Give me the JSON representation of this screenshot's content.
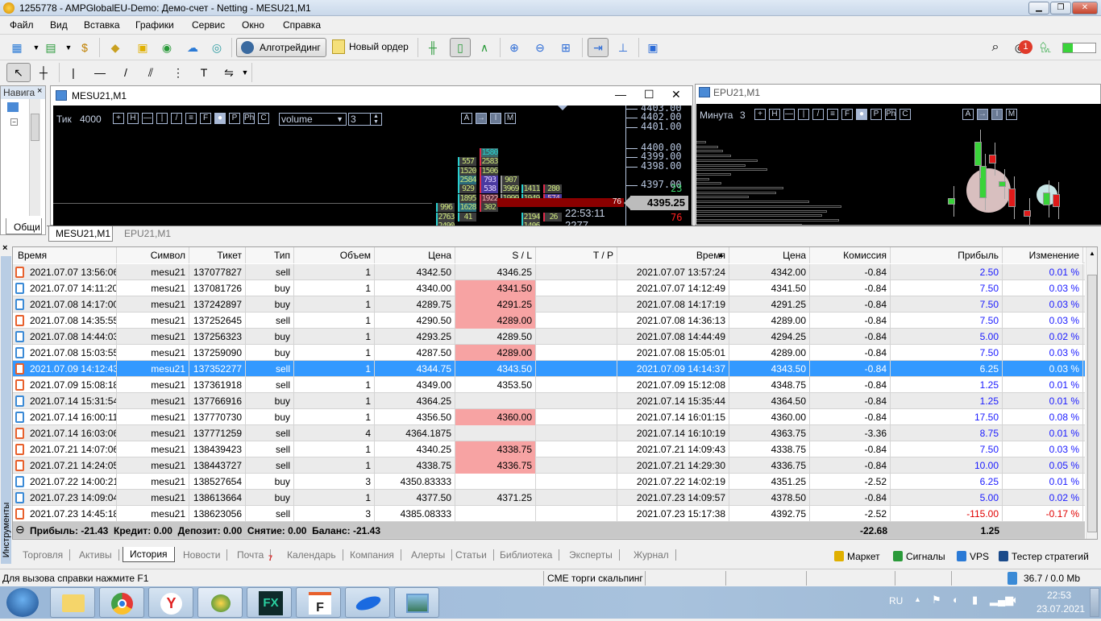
{
  "window": {
    "title": "1255778 - AMPGlobalEU-Demo: Демо-счет - Netting - MESU21,M1"
  },
  "menu": [
    "Файл",
    "Вид",
    "Вставка",
    "Графики",
    "Сервис",
    "Окно",
    "Справка"
  ],
  "toolbar": {
    "algo_label": "Алготрейдинг",
    "new_order_label": "Новый ордер",
    "notifications_count": "1",
    "lvl_label": "LVL",
    "signal_strength": 0.3
  },
  "navigator": {
    "title": "Навига",
    "tab": "Общи"
  },
  "chart_main": {
    "title": "MESU21,M1",
    "timeframe_label": "Тик",
    "timeframe_value": "4000",
    "mode_select": "volume",
    "mode_value": "3",
    "tool_buttons": [
      "+",
      "H",
      "—",
      "|",
      "/",
      "≡",
      "F",
      "●",
      "P",
      "Ph",
      "C"
    ],
    "right_buttons": [
      "A",
      "→",
      "I",
      "M"
    ],
    "price_labels": [
      "4403.00",
      "4402.00",
      "4401.00",
      "4400.00",
      "4399.00",
      "4398.00",
      "4397.00"
    ],
    "ask_volume": "23",
    "current_price": "4395.25",
    "bid_volume": "76",
    "level_volume": "76",
    "time": "22:53:11",
    "tick_count": "2277",
    "clusters": [
      {
        "start": 6,
        "values": [
          "996",
          "2763",
          "2490"
        ]
      },
      {
        "start": 1,
        "values": [
          "557",
          "1520",
          "2584",
          "929",
          "1895",
          "1628",
          "41"
        ]
      },
      {
        "start": 0,
        "values": [
          "1580",
          "2583",
          "1506",
          "793",
          "538",
          "1922",
          "302"
        ]
      },
      {
        "start": 3,
        "values": [
          "907",
          "3969",
          "1999"
        ]
      },
      {
        "start": 4,
        "values": [
          "1411",
          "1949",
          "",
          "2194",
          "1406"
        ]
      },
      {
        "start": 4,
        "values": [
          "280",
          "574",
          "",
          "26"
        ]
      }
    ]
  },
  "chart_second": {
    "title": "EPU21,M1",
    "timeframe_label": "Минута",
    "timeframe_value": "3",
    "tool_buttons": [
      "+",
      "H",
      "—",
      "|",
      "/",
      "≡",
      "F",
      "●",
      "P",
      "Ph",
      "C"
    ],
    "right_buttons": [
      "A",
      "→",
      "I",
      "M"
    ]
  },
  "chart_tabs": [
    "MESU21,M1",
    "EPU21,M1"
  ],
  "history": {
    "columns": [
      "Время",
      "Символ",
      "Тикет",
      "Тип",
      "Объем",
      "Цена",
      "S / L",
      "T / P",
      "Время",
      "Цена",
      "Комиссия",
      "Прибыль",
      "Изменение"
    ],
    "rows": [
      {
        "open_time": "2021.07.07 13:56:06",
        "symbol": "mesu21",
        "ticket": "137077827",
        "type": "sell",
        "volume": "1",
        "price": "4342.50",
        "sl": "4346.25",
        "sl_hit": false,
        "tp": "",
        "close_time": "2021.07.07 13:57:24",
        "close_price": "4342.00",
        "commission": "-0.84",
        "profit": "2.50",
        "change": "0.01 %"
      },
      {
        "open_time": "2021.07.07 14:11:20",
        "symbol": "mesu21",
        "ticket": "137081726",
        "type": "buy",
        "volume": "1",
        "price": "4340.00",
        "sl": "4341.50",
        "sl_hit": true,
        "tp": "",
        "close_time": "2021.07.07 14:12:49",
        "close_price": "4341.50",
        "commission": "-0.84",
        "profit": "7.50",
        "change": "0.03 %"
      },
      {
        "open_time": "2021.07.08 14:17:00",
        "symbol": "mesu21",
        "ticket": "137242897",
        "type": "buy",
        "volume": "1",
        "price": "4289.75",
        "sl": "4291.25",
        "sl_hit": true,
        "tp": "",
        "close_time": "2021.07.08 14:17:19",
        "close_price": "4291.25",
        "commission": "-0.84",
        "profit": "7.50",
        "change": "0.03 %"
      },
      {
        "open_time": "2021.07.08 14:35:55",
        "symbol": "mesu21",
        "ticket": "137252645",
        "type": "sell",
        "volume": "1",
        "price": "4290.50",
        "sl": "4289.00",
        "sl_hit": true,
        "tp": "",
        "close_time": "2021.07.08 14:36:13",
        "close_price": "4289.00",
        "commission": "-0.84",
        "profit": "7.50",
        "change": "0.03 %"
      },
      {
        "open_time": "2021.07.08 14:44:03",
        "symbol": "mesu21",
        "ticket": "137256323",
        "type": "buy",
        "volume": "1",
        "price": "4293.25",
        "sl": "4289.50",
        "sl_hit": false,
        "tp": "",
        "close_time": "2021.07.08 14:44:49",
        "close_price": "4294.25",
        "commission": "-0.84",
        "profit": "5.00",
        "change": "0.02 %"
      },
      {
        "open_time": "2021.07.08 15:03:55",
        "symbol": "mesu21",
        "ticket": "137259090",
        "type": "buy",
        "volume": "1",
        "price": "4287.50",
        "sl": "4289.00",
        "sl_hit": true,
        "tp": "",
        "close_time": "2021.07.08 15:05:01",
        "close_price": "4289.00",
        "commission": "-0.84",
        "profit": "7.50",
        "change": "0.03 %"
      },
      {
        "open_time": "2021.07.09 14:12:43",
        "symbol": "mesu21",
        "ticket": "137352277",
        "type": "sell",
        "volume": "1",
        "price": "4344.75",
        "sl": "4343.50",
        "sl_hit": true,
        "tp": "",
        "close_time": "2021.07.09 14:14:37",
        "close_price": "4343.50",
        "commission": "-0.84",
        "profit": "6.25",
        "change": "0.03 %",
        "selected": true
      },
      {
        "open_time": "2021.07.09 15:08:18",
        "symbol": "mesu21",
        "ticket": "137361918",
        "type": "sell",
        "volume": "1",
        "price": "4349.00",
        "sl": "4353.50",
        "sl_hit": false,
        "tp": "",
        "close_time": "2021.07.09 15:12:08",
        "close_price": "4348.75",
        "commission": "-0.84",
        "profit": "1.25",
        "change": "0.01 %"
      },
      {
        "open_time": "2021.07.14 15:31:54",
        "symbol": "mesu21",
        "ticket": "137766916",
        "type": "buy",
        "volume": "1",
        "price": "4364.25",
        "sl": "",
        "sl_hit": false,
        "tp": "",
        "close_time": "2021.07.14 15:35:44",
        "close_price": "4364.50",
        "commission": "-0.84",
        "profit": "1.25",
        "change": "0.01 %"
      },
      {
        "open_time": "2021.07.14 16:00:11",
        "symbol": "mesu21",
        "ticket": "137770730",
        "type": "buy",
        "volume": "1",
        "price": "4356.50",
        "sl": "4360.00",
        "sl_hit": true,
        "tp": "",
        "close_time": "2021.07.14 16:01:15",
        "close_price": "4360.00",
        "commission": "-0.84",
        "profit": "17.50",
        "change": "0.08 %"
      },
      {
        "open_time": "2021.07.14 16:03:06",
        "symbol": "mesu21",
        "ticket": "137771259",
        "type": "sell",
        "volume": "4",
        "price": "4364.1875",
        "sl": "",
        "sl_hit": false,
        "tp": "",
        "close_time": "2021.07.14 16:10:19",
        "close_price": "4363.75",
        "commission": "-3.36",
        "profit": "8.75",
        "change": "0.01 %"
      },
      {
        "open_time": "2021.07.21 14:07:06",
        "symbol": "mesu21",
        "ticket": "138439423",
        "type": "sell",
        "volume": "1",
        "price": "4340.25",
        "sl": "4338.75",
        "sl_hit": true,
        "tp": "",
        "close_time": "2021.07.21 14:09:43",
        "close_price": "4338.75",
        "commission": "-0.84",
        "profit": "7.50",
        "change": "0.03 %"
      },
      {
        "open_time": "2021.07.21 14:24:05",
        "symbol": "mesu21",
        "ticket": "138443727",
        "type": "sell",
        "volume": "1",
        "price": "4338.75",
        "sl": "4336.75",
        "sl_hit": true,
        "tp": "",
        "close_time": "2021.07.21 14:29:30",
        "close_price": "4336.75",
        "commission": "-0.84",
        "profit": "10.00",
        "change": "0.05 %"
      },
      {
        "open_time": "2021.07.22 14:00:21",
        "symbol": "mesu21",
        "ticket": "138527654",
        "type": "buy",
        "volume": "3",
        "price": "4350.83333",
        "sl": "",
        "sl_hit": false,
        "tp": "",
        "close_time": "2021.07.22 14:02:19",
        "close_price": "4351.25",
        "commission": "-2.52",
        "profit": "6.25",
        "change": "0.01 %"
      },
      {
        "open_time": "2021.07.23 14:09:04",
        "symbol": "mesu21",
        "ticket": "138613664",
        "type": "buy",
        "volume": "1",
        "price": "4377.50",
        "sl": "4371.25",
        "sl_hit": false,
        "tp": "",
        "close_time": "2021.07.23 14:09:57",
        "close_price": "4378.50",
        "commission": "-0.84",
        "profit": "5.00",
        "change": "0.02 %"
      },
      {
        "open_time": "2021.07.23 14:45:18",
        "symbol": "mesu21",
        "ticket": "138623056",
        "type": "sell",
        "volume": "3",
        "price": "4385.08333",
        "sl": "",
        "sl_hit": false,
        "tp": "",
        "close_time": "2021.07.23 15:17:38",
        "close_price": "4392.75",
        "commission": "-2.52",
        "profit": "-115.00",
        "change": "-0.17 %",
        "loss": true
      }
    ],
    "summary": {
      "text": "Прибыль: -21.43  Кредит: 0.00  Депозит: 0.00  Снятие: 0.00  Баланс: -21.43",
      "commission_total": "-22.68",
      "profit_total": "1.25"
    }
  },
  "side_label": "Инструменты",
  "bottom_tabs": [
    "Торговля",
    "Активы",
    "История",
    "Новости",
    "Почта",
    "Календарь",
    "Компания",
    "Алерты",
    "Статьи",
    "Библиотека",
    "Эксперты",
    "Журнал"
  ],
  "mail_badge": "7",
  "active_tab": "История",
  "right_links": [
    "Маркет",
    "Сигналы",
    "VPS",
    "Тестер стратегий"
  ],
  "status": {
    "help": "Для вызова справки нажмите F1",
    "profile": "CME торги скальпинг",
    "traffic": "36.7 / 0.0 Mb"
  },
  "taskbar": {
    "lang": "RU",
    "time": "22:53",
    "date": "23.07.2021"
  },
  "colors": {
    "selected_row": "#3399ff",
    "sl_hit": "#f7a3a3",
    "profit": "#1a1aff",
    "loss": "#e00000",
    "sell_icon": "#e8602c",
    "buy_icon": "#3a8ad6"
  }
}
